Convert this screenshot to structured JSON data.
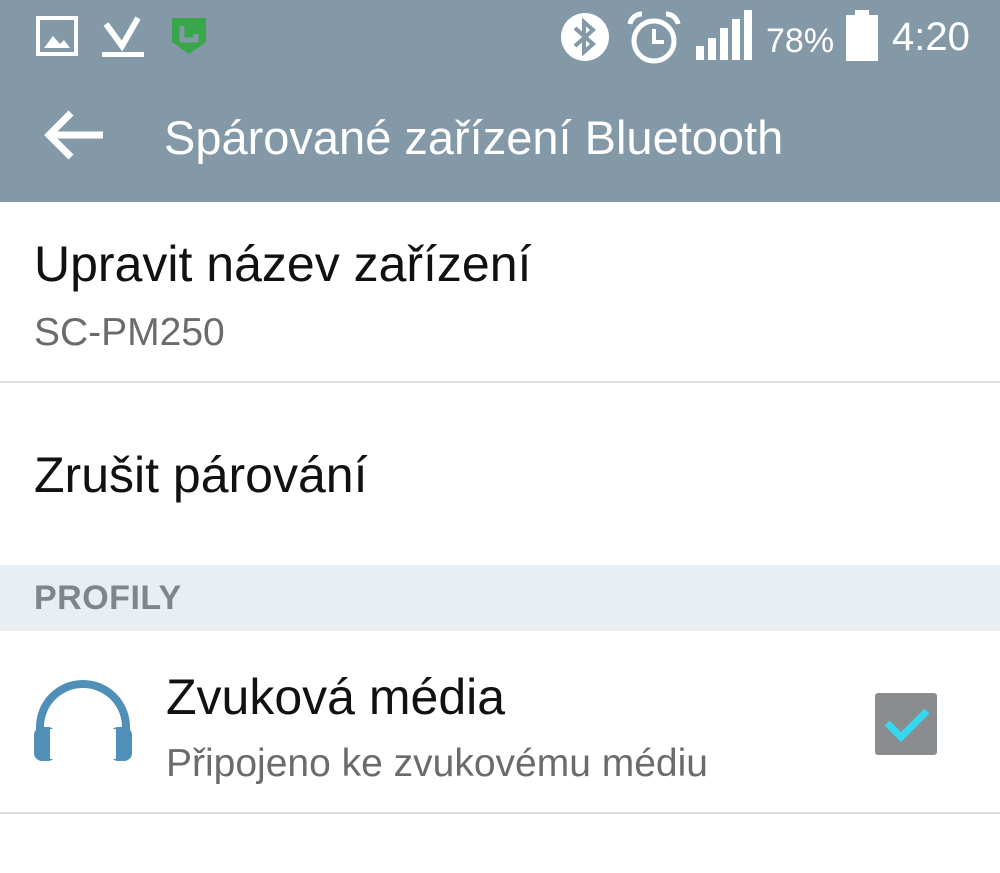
{
  "status_bar": {
    "left_icons": [
      "gallery-icon",
      "download-done-icon",
      "shield-app-icon"
    ],
    "right_icons": [
      "bluetooth-icon",
      "alarm-icon",
      "signal-icon",
      "battery-icon"
    ],
    "battery_percent": "78%",
    "time": "4:20"
  },
  "app_bar": {
    "back_icon": "arrow-back-icon",
    "title": "Spárované zařízení Bluetooth"
  },
  "rows": {
    "rename": {
      "title": "Upravit název zařízení",
      "subtitle": "SC-PM250"
    },
    "unpair": {
      "title": "Zrušit párování"
    }
  },
  "profiles": {
    "header": "PROFILY",
    "items": [
      {
        "icon": "headphones-icon",
        "title": "Zvuková média",
        "subtitle": "Připojeno ke zvukovému médiu",
        "checked": true
      }
    ]
  },
  "colors": {
    "bar": "#8499a8",
    "section_bg": "#e8eef1",
    "check_accent": "#37d7ef",
    "headphones": "#4f8fb8"
  }
}
